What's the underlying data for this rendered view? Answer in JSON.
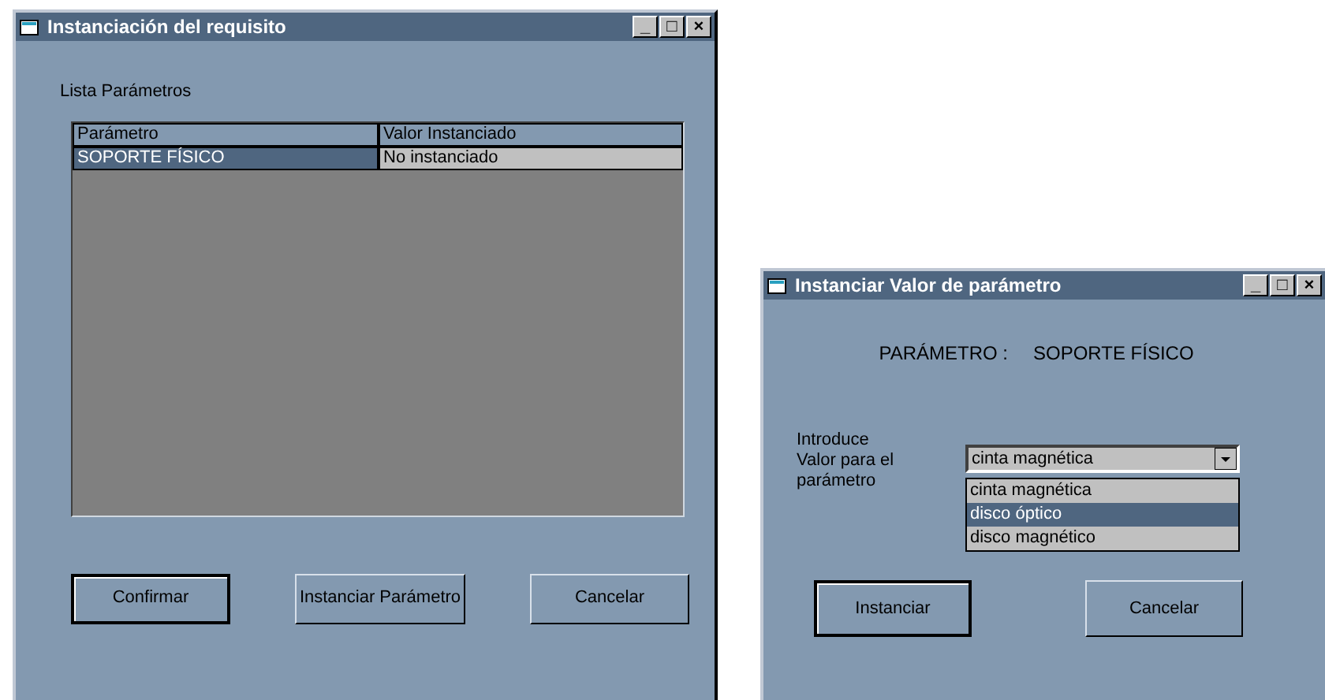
{
  "main_window": {
    "title": "Instanciación del requisito",
    "title_buttons": [
      "_",
      "□",
      "×"
    ],
    "list_label": "Lista Parámetros",
    "table": {
      "columns": [
        "Parámetro",
        "Valor Instanciado"
      ],
      "rows": [
        {
          "cells": [
            "SOPORTE FÍSICO",
            "No instanciado"
          ],
          "selected": true
        }
      ]
    },
    "buttons": [
      {
        "label": "Confirmar",
        "default": true
      },
      {
        "label": "Instanciar Parámetro",
        "default": false
      },
      {
        "label": "Cancelar",
        "default": false
      }
    ]
  },
  "dialog": {
    "title": "Instanciar Valor de parámetro",
    "title_buttons": [
      "_",
      "□",
      "×"
    ],
    "parameter_label": "PARÁMETRO :",
    "parameter_value": "SOPORTE FÍSICO",
    "prompt": "Introduce Valor para el parámetro",
    "combo": {
      "value": "cinta magnética",
      "expanded": true,
      "options": [
        {
          "label": "cinta magnética",
          "highlighted": false
        },
        {
          "label": "disco óptico",
          "highlighted": true
        },
        {
          "label": "disco magnético",
          "highlighted": false
        }
      ]
    },
    "buttons": [
      {
        "label": "Instanciar",
        "default": true
      },
      {
        "label": "Cancelar",
        "default": false
      }
    ]
  }
}
